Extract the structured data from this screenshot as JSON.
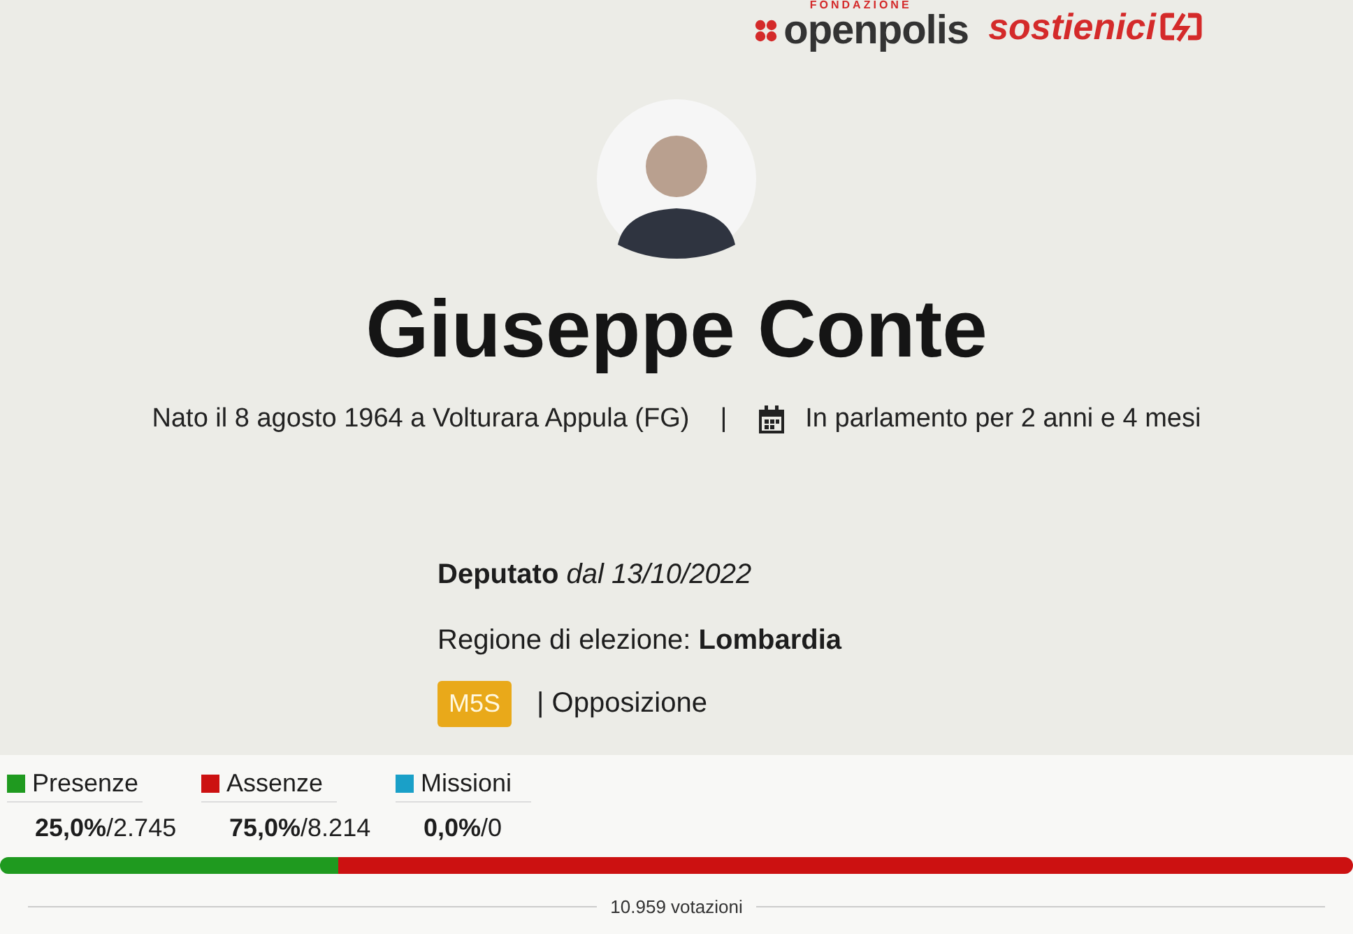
{
  "header": {
    "logo_tagline": "FONDAZIONE",
    "logo_name": "openpolis",
    "support_link": "sostienici"
  },
  "profile": {
    "name": "Giuseppe Conte",
    "birth": "Nato il 8 agosto 1964 a Volturara Appula (FG)",
    "separator": "|",
    "tenure": "In parlamento per 2 anni e 4 mesi"
  },
  "details": {
    "role": "**Deputato** *dal 13/10/2022*",
    "region": "Regione di elezione: **Lombardia**",
    "party": "M5S",
    "alignment": "| Opposizione"
  },
  "stats": [
    {
      "label": "Presenze",
      "color": "#1f9a1f",
      "value": "**25,0%**/2.745",
      "level": 0.25
    },
    {
      "label": "Assenze",
      "color": "#cc1111",
      "value": "**75,0%**/8.214",
      "level": 0.75
    },
    {
      "label": "Missioni",
      "color": "#1aa0c8",
      "value": "**0,0%**/0"
    }
  ],
  "total": "10.959 votazioni"
}
